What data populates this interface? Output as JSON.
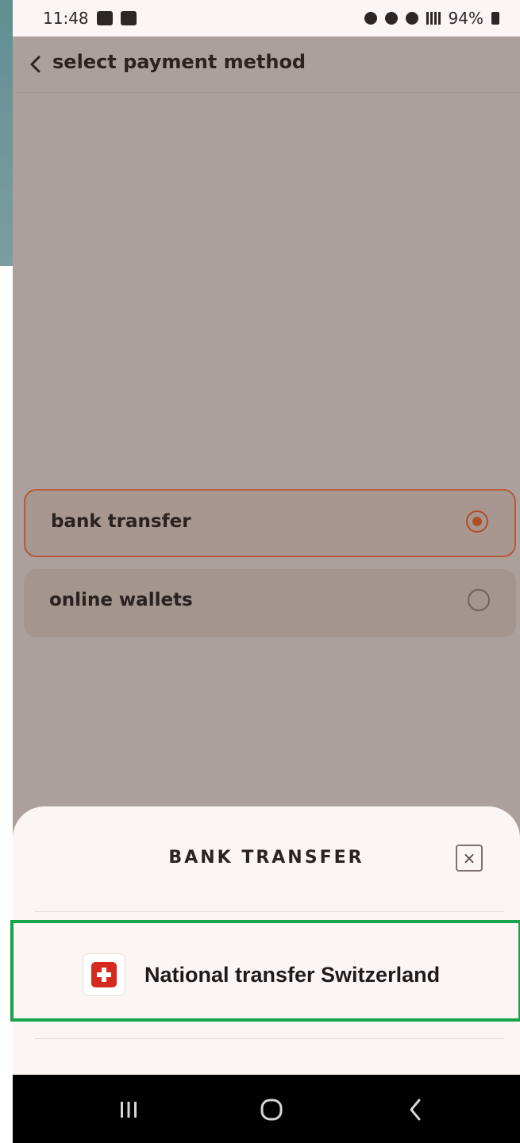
{
  "status_bar": {
    "time": "11:48",
    "battery": "94%"
  },
  "header": {
    "title": "select payment method"
  },
  "options": [
    {
      "label": "bank transfer",
      "selected": true
    },
    {
      "label": "online wallets",
      "selected": false
    }
  ],
  "sheet": {
    "title": "BANK TRANSFER",
    "close_icon": "close-icon",
    "items": [
      {
        "label": "National transfer Switzerland",
        "icon": "swiss-flag-icon"
      }
    ]
  },
  "colors": {
    "accent": "#b14e25",
    "highlight": "#16a34a",
    "background": "#aca09d"
  }
}
